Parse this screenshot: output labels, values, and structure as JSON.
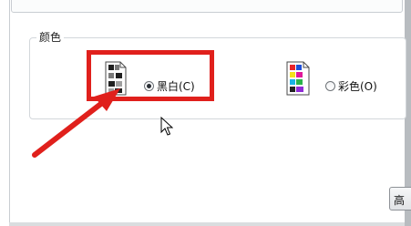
{
  "color_section": {
    "title": "颜色",
    "options": [
      {
        "label": "黑白(C)",
        "selected": true,
        "icon": "black-white-printer-icon"
      },
      {
        "label": "彩色(O)",
        "selected": false,
        "icon": "color-printer-icon"
      }
    ]
  },
  "dialog_button": {
    "label": "高"
  },
  "annotation": {
    "highlight_color": "#e0201c",
    "arrow_color": "#e0201c"
  }
}
